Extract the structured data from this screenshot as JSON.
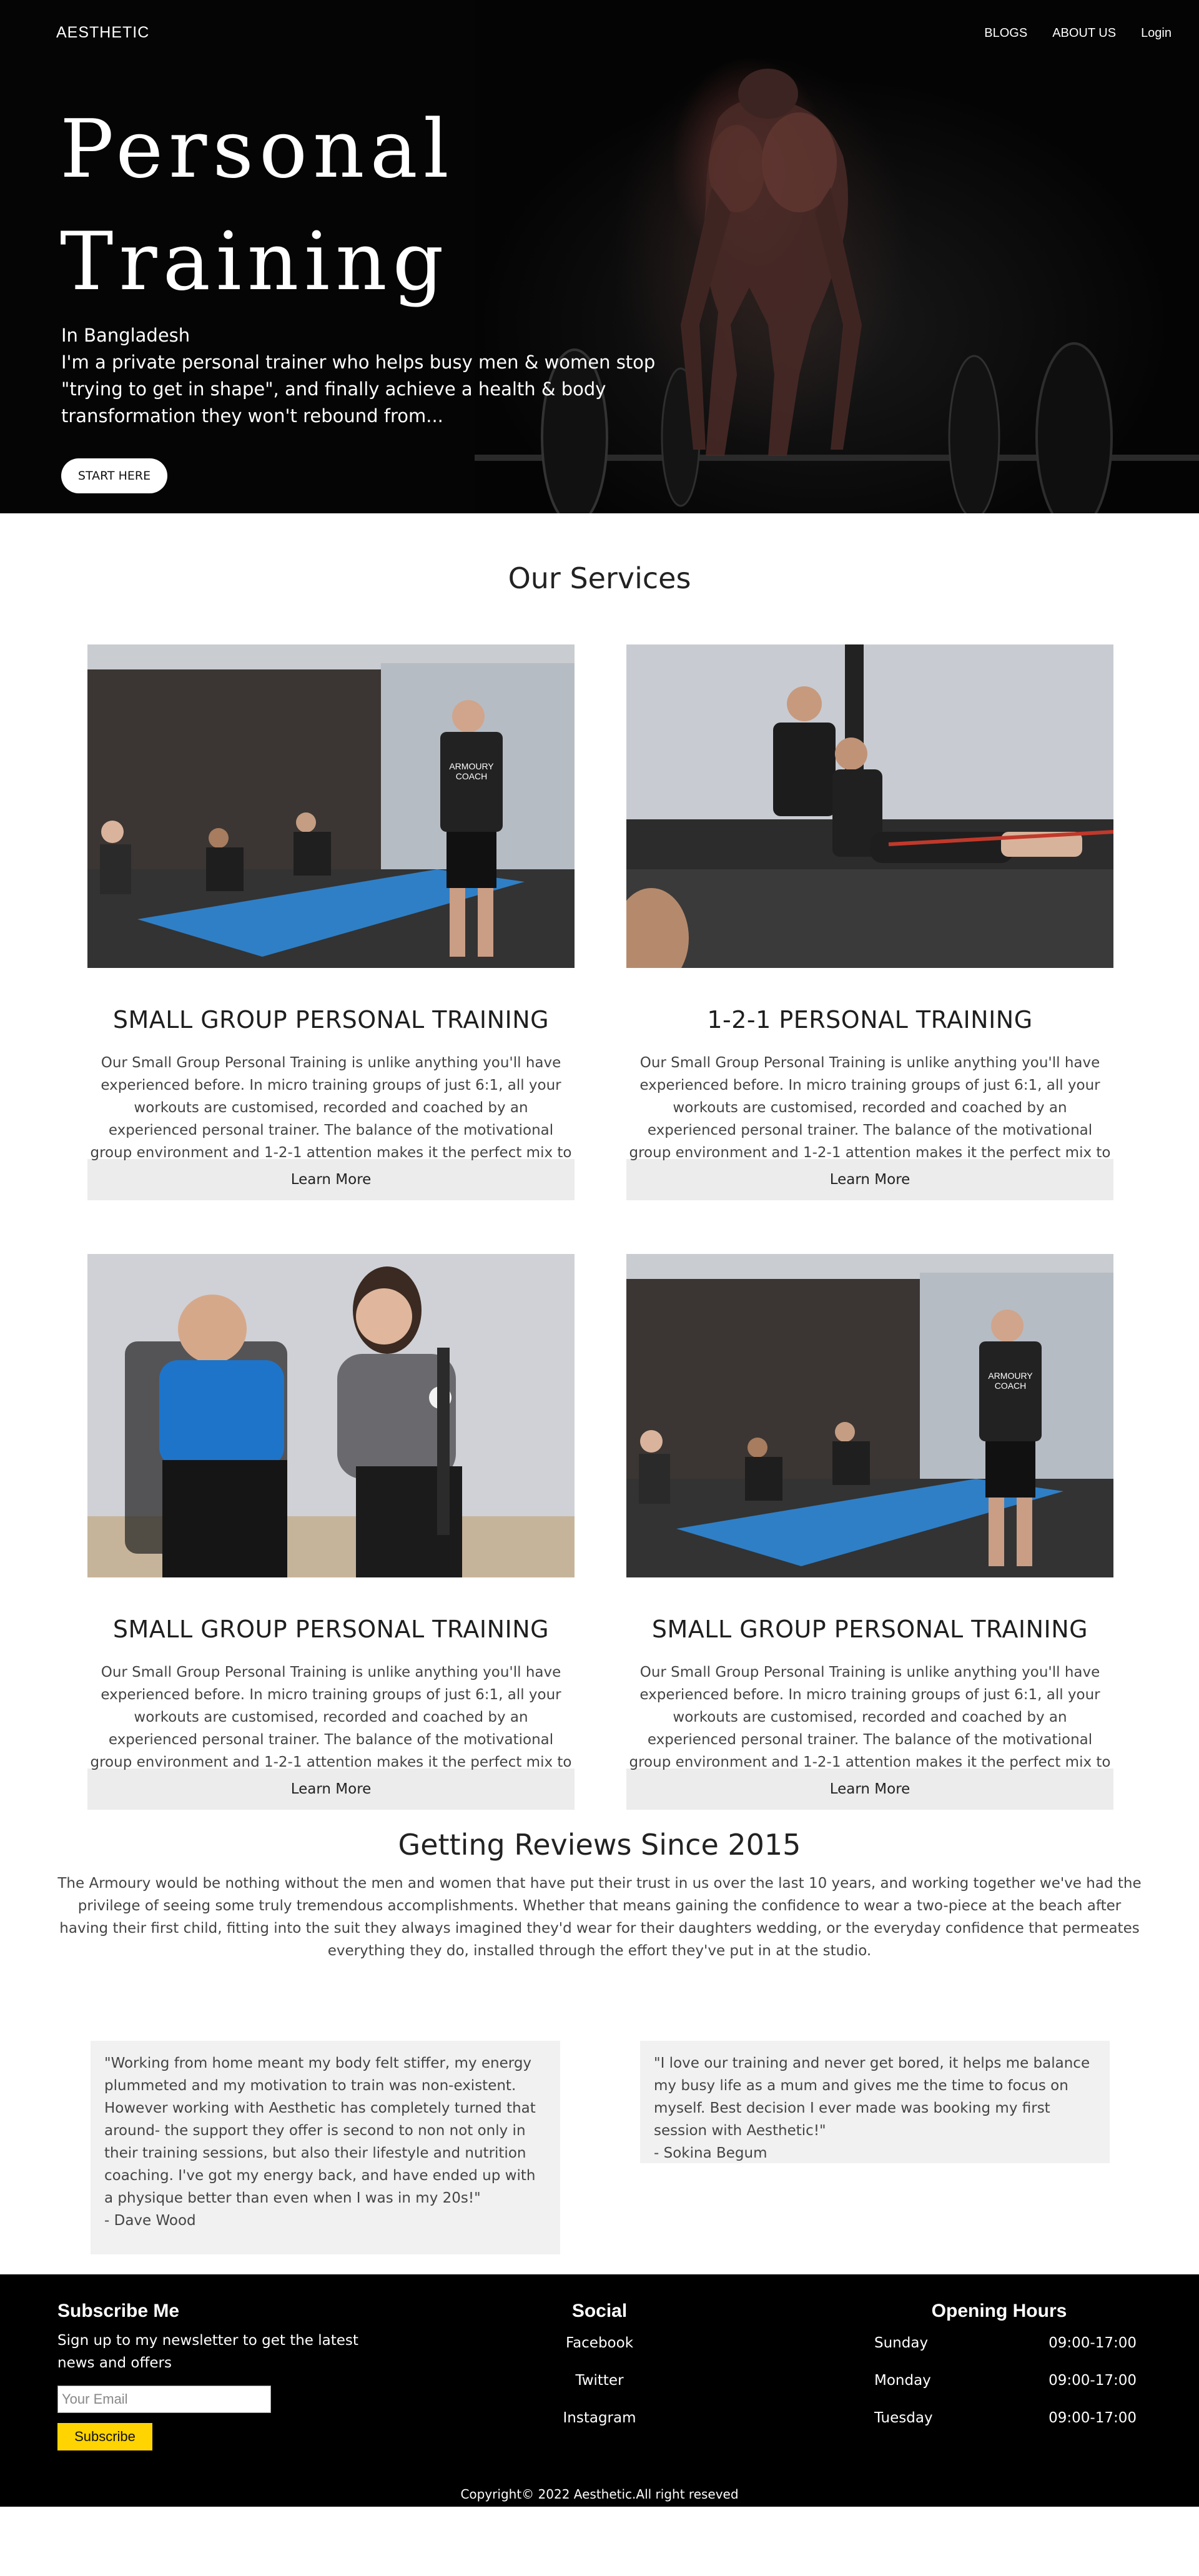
{
  "nav": {
    "brand": "AESTHETIC",
    "links": [
      "BLOGS",
      "ABOUT US",
      "Login"
    ]
  },
  "hero": {
    "title_line1": "Personal",
    "title_line2": "Training",
    "subtitle": "In Bangladesh",
    "description": "I'm a private personal trainer who helps busy men & women stop \"trying to get in shape\", and finally achieve a health & body transformation they won't rebound from...",
    "cta": "START HERE"
  },
  "services": {
    "title": "Our Services",
    "learn_more": "Learn More",
    "cards": [
      {
        "title": "SMALL GROUP PERSONAL TRAINING",
        "text": "Our Small Group Personal Training is unlike anything you'll have experienced before. In micro training groups of just 6:1, all your workouts are customised, recorded and coached by an experienced personal trainer. The balance of the motivational group environment and 1-2-1 attention makes it the perfect mix to produce fast results, without the",
        "image": "group-training-photo"
      },
      {
        "title": "1-2-1 PERSONAL TRAINING",
        "text": "Our Small Group Personal Training is unlike anything you'll have experienced before. In micro training groups of just 6:1, all your workouts are customised, recorded and coached by an experienced personal trainer. The balance of the motivational group environment and 1-2-1 attention makes it the perfect mix to",
        "image": "one-to-one-training-photo"
      },
      {
        "title": "SMALL GROUP PERSONAL TRAINING",
        "text": "Our Small Group Personal Training is unlike anything you'll have experienced before. In micro training groups of just 6:1, all your workouts are customised, recorded and coached by an experienced personal trainer. The balance of the motivational group environment and 1-2-1 attention makes it the perfect mix to produce fast results, without the",
        "image": "consultation-photo"
      },
      {
        "title": "SMALL GROUP PERSONAL TRAINING",
        "text": "Our Small Group Personal Training is unlike anything you'll have experienced before. In micro training groups of just 6:1, all your workouts are customised, recorded and coached by an experienced personal trainer. The balance of the motivational group environment and 1-2-1 attention makes it the perfect mix to produce fast results, without the",
        "image": "group-training-photo"
      }
    ]
  },
  "reviews": {
    "title": "Getting Reviews Since 2015",
    "intro": "The Armoury would be nothing without the men and women that have put their trust in us over the last 10 years, and working together we've had the privilege of seeing some truly tremendous accomplishments. Whether that means gaining the confidence to wear a two-piece at the beach after having their first child, fitting into the suit they always imagined they'd wear for their daughters wedding, or the everyday confidence that permeates everything they do, installed through the effort they've put in at the studio.",
    "testimonials": [
      {
        "quote": "\"Working from home meant my body felt stiffer, my energy plummeted and my motivation to train was non-existent. However working with Aesthetic has completely turned that around- the support they offer is second to non not only in their training sessions, but also their lifestyle and nutrition coaching. I've got my energy back, and have ended up with a physique better than even when I was in my 20s!\"",
        "author": "- Dave Wood"
      },
      {
        "quote": "\"I love our training and never get bored, it helps me balance my busy life as a mum and gives me the time to focus on myself. Best decision I ever made was booking my first session with Aesthetic!\"",
        "author": "- Sokina Begum"
      }
    ]
  },
  "footer": {
    "subscribe": {
      "title": "Subscribe Me",
      "text": "Sign up to my newsletter to get the latest news and offers",
      "placeholder": "Your Email",
      "button": "Subscribe",
      "button_color": "#ffd400"
    },
    "social": {
      "title": "Social",
      "links": [
        "Facebook",
        "Twitter",
        "Instagram"
      ]
    },
    "hours": {
      "title": "Opening Hours",
      "rows": [
        {
          "day": "Sunday",
          "time": "09:00-17:00"
        },
        {
          "day": "Monday",
          "time": "09:00-17:00"
        },
        {
          "day": "Tuesday",
          "time": "09:00-17:00"
        }
      ]
    },
    "copyright": "Copyright© 2022 Aesthetic.All right reseved"
  }
}
